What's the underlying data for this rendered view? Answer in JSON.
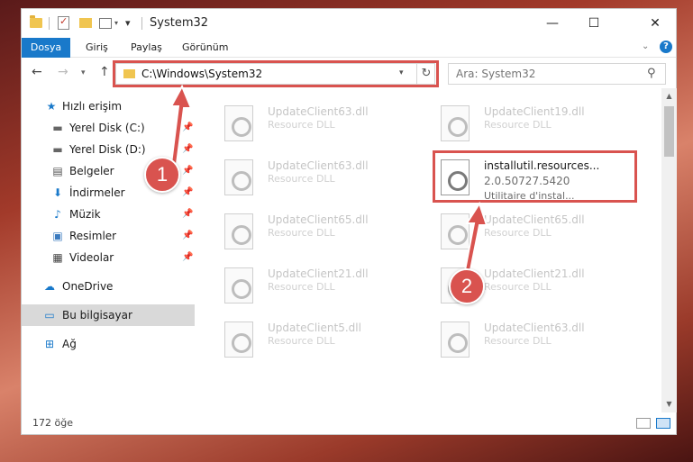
{
  "window": {
    "title": "System32",
    "controls": {
      "minimize": "—",
      "maximize": "☐",
      "close": "✕"
    }
  },
  "ribbon": {
    "tabs": [
      {
        "label": "Dosya",
        "active": true
      },
      {
        "label": "Giriş"
      },
      {
        "label": "Paylaş"
      },
      {
        "label": "Görünüm"
      }
    ],
    "help": "?"
  },
  "address": {
    "path": "C:\\Windows\\System32"
  },
  "search": {
    "placeholder": "Ara: System32"
  },
  "sidebar": {
    "items": [
      {
        "label": "Hızlı erişim",
        "icon": "star-icon",
        "pinned": false
      },
      {
        "label": "Yerel Disk (C:)",
        "icon": "drive-icon",
        "pinned": true
      },
      {
        "label": "Yerel Disk (D:)",
        "icon": "drive-icon",
        "pinned": true
      },
      {
        "label": "Belgeler",
        "icon": "document-icon",
        "pinned": true
      },
      {
        "label": "İndirmeler",
        "icon": "download-icon",
        "pinned": true
      },
      {
        "label": "Müzik",
        "icon": "music-icon",
        "pinned": true
      },
      {
        "label": "Resimler",
        "icon": "image-icon",
        "pinned": true
      },
      {
        "label": "Videolar",
        "icon": "video-icon",
        "pinned": true
      },
      {
        "label": "OneDrive",
        "icon": "cloud-icon",
        "pinned": false
      },
      {
        "label": "Bu bilgisayar",
        "icon": "computer-icon",
        "pinned": false,
        "selected": true
      },
      {
        "label": "Ağ",
        "icon": "network-icon",
        "pinned": false
      }
    ]
  },
  "files": [
    {
      "name": "UpdateClient63.dll",
      "desc": "Resource DLL"
    },
    {
      "name": "UpdateClient19.dll",
      "desc": "Resource DLL"
    },
    {
      "name": "UpdateClient63.dll",
      "desc": "Resource DLL"
    },
    {
      "name": "installutil.resources...",
      "version": "2.0.50727.5420",
      "desc": "Utilitaire d'instal...",
      "active": true
    },
    {
      "name": "UpdateClient65.dll",
      "desc": "Resource DLL"
    },
    {
      "name": "UpdateClient65.dll",
      "desc": "Resource DLL"
    },
    {
      "name": "UpdateClient21.dll",
      "desc": "Resource DLL"
    },
    {
      "name": "UpdateClient21.dll",
      "desc": "Resource DLL"
    },
    {
      "name": "UpdateClient5.dll",
      "desc": "Resource DLL"
    },
    {
      "name": "UpdateClient63.dll",
      "desc": "Resource DLL"
    }
  ],
  "status": {
    "item_count": "172 öğe"
  },
  "annotations": {
    "step1": "1",
    "step2": "2",
    "color": "#d9534f"
  }
}
